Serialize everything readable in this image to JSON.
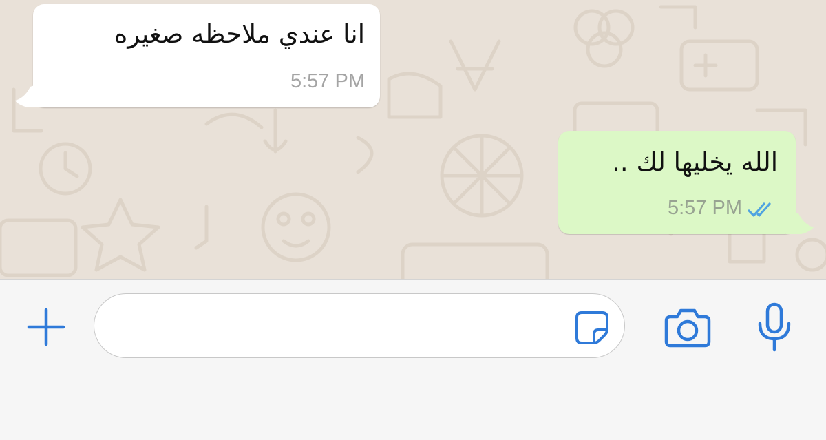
{
  "chat": {
    "messages": [
      {
        "direction": "incoming",
        "text": "انا عندي ملاحظه صغيره",
        "time": "5:57 PM"
      },
      {
        "direction": "outgoing",
        "text": "الله يخليها لك ..",
        "time": "5:57 PM",
        "status": "read"
      }
    ]
  },
  "composer": {
    "input_value": "",
    "icons": {
      "attach": "plus-icon",
      "sticker": "sticker-icon",
      "camera": "camera-icon",
      "mic": "microphone-icon"
    }
  },
  "colors": {
    "accent": "#2f7ad9",
    "incoming_bubble": "#ffffff",
    "outgoing_bubble": "#dcf8c6",
    "wallpaper": "#e9e1d8",
    "read_ticks": "#4fa3e0"
  }
}
